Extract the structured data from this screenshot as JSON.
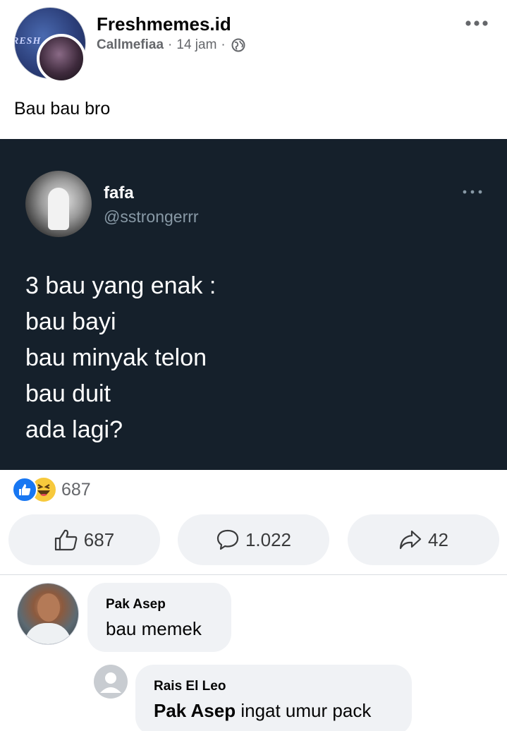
{
  "post": {
    "page_name": "Freshmemes.id",
    "page_avatar_text": "RESH",
    "author": "Callmefiaa",
    "separator": "·",
    "time": "14 jam",
    "caption": "Bau bau bro"
  },
  "tweet": {
    "name": "fafa",
    "handle": "@sstrongerrr",
    "lines": [
      "3 bau yang enak :",
      "bau bayi",
      "bau minyak telon",
      "bau duit",
      "ada lagi?"
    ]
  },
  "reactions": {
    "count": "687"
  },
  "actions": {
    "like_count": "687",
    "comment_count": "1.022",
    "share_count": "42"
  },
  "comments": [
    {
      "author": "Pak Asep",
      "text": "bau memek"
    },
    {
      "author": "Rais El Leo",
      "mention": "Pak Asep",
      "text": " ingat umur pack"
    }
  ],
  "colors": {
    "facebook_blue": "#1877f2",
    "haha_yellow": "#f7c93c",
    "tweet_background": "#15202b",
    "bubble_gray": "#f0f2f5",
    "secondary_text": "#65676b"
  },
  "icons": [
    "globe-icon",
    "more-icon",
    "like-icon",
    "haha-icon",
    "comment-icon",
    "share-icon",
    "default-avatar-icon"
  ]
}
